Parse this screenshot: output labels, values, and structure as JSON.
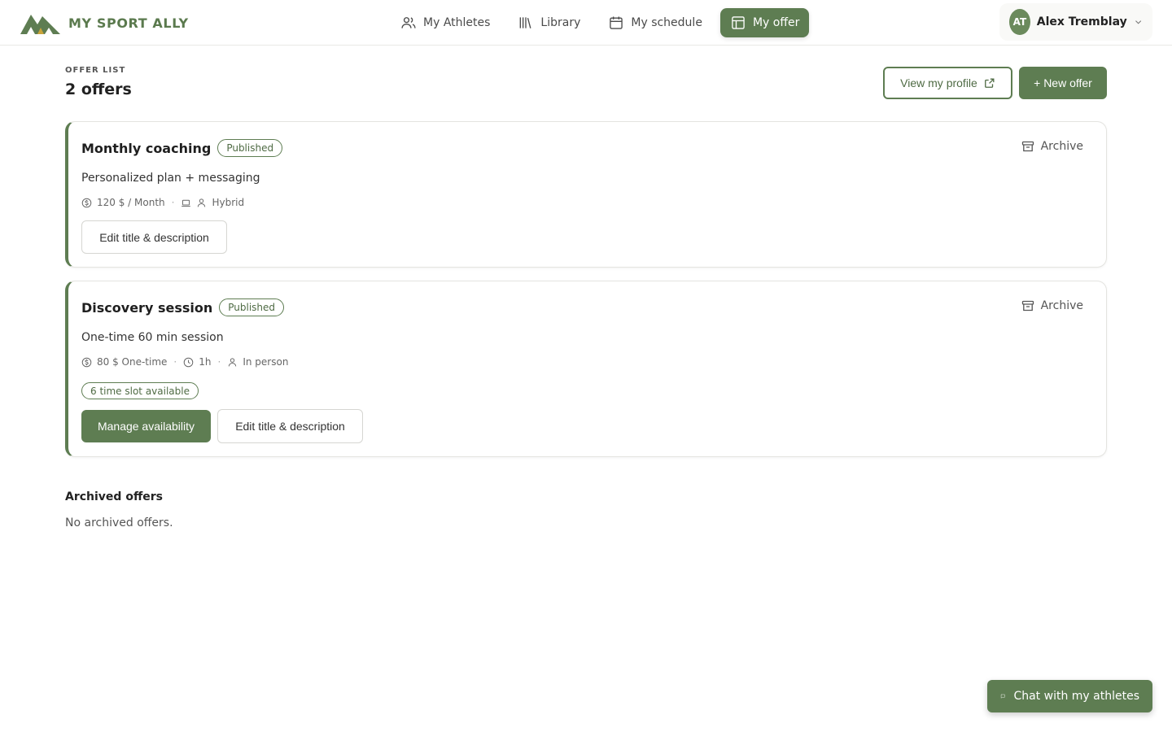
{
  "brand": {
    "name": "MY SPORT ALLY",
    "color": "#5b7a4e"
  },
  "nav": {
    "items": [
      {
        "label": "My Athletes",
        "icon": "users-icon",
        "active": false
      },
      {
        "label": "Library",
        "icon": "library-icon",
        "active": false
      },
      {
        "label": "My schedule",
        "icon": "calendar-icon",
        "active": false
      },
      {
        "label": "My offer",
        "icon": "layout-icon",
        "active": true
      }
    ]
  },
  "user": {
    "initials": "AT",
    "name": "Alex Tremblay"
  },
  "page": {
    "eyebrow": "OFFER LIST",
    "title": "2 offers",
    "view_profile": "View my profile",
    "new_offer": "+ New offer"
  },
  "offers": [
    {
      "title": "Monthly coaching",
      "status": "Published",
      "archive": "Archive",
      "description": "Personalized plan + messaging",
      "price": "120 $ / Month",
      "mode": "Hybrid",
      "edit": "Edit title & description"
    },
    {
      "title": "Discovery session",
      "status": "Published",
      "archive": "Archive",
      "description": "One-time 60 min session",
      "price": "80 $ One-time",
      "duration": "1h",
      "mode": "In person",
      "slots": "6 time slot available",
      "manage": "Manage availability",
      "edit": "Edit title & description"
    }
  ],
  "archived": {
    "title": "Archived offers",
    "empty": "No archived offers."
  },
  "chat": {
    "label": "Chat with my athletes"
  },
  "colors": {
    "accent": "#5e7d52",
    "border": "#e4e4e0"
  }
}
